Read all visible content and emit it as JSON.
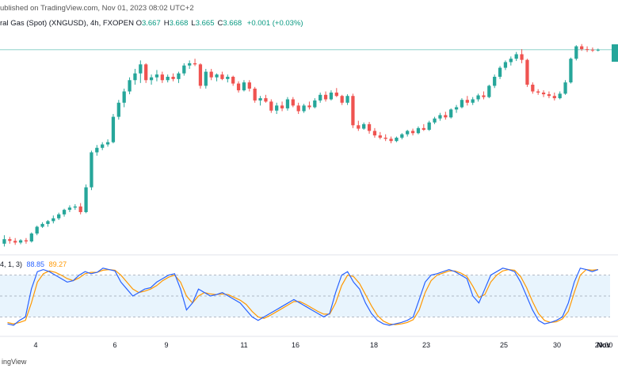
{
  "header": {
    "published": "ublished on TradingView.com, Nov 01, 2023 08:02 UTC+2",
    "symbol": "ral Gas (Spot) (XNGUSD), 4h, FXOPEN",
    "ohlc": [
      {
        "label": "O",
        "value": "3.667"
      },
      {
        "label": "H",
        "value": "3.668"
      },
      {
        "label": "L",
        "value": "3.665"
      },
      {
        "label": "C",
        "value": "3.668"
      }
    ],
    "change": "+0.001 (+0.03%)"
  },
  "indicator": {
    "params": "4, 1, 3)",
    "k_value": "88.85",
    "d_value": "89.27"
  },
  "footer": {
    "text": "ingView"
  },
  "colors": {
    "up": "#26a69a",
    "down": "#ef5350",
    "k_line": "#2962ff",
    "d_line": "#ff9800",
    "band": "#e8f4fd",
    "price_line": "#26a69a"
  },
  "chart_data": [
    {
      "type": "candlestick",
      "x_tick_labels": [
        "4",
        "6",
        "9",
        "11",
        "16",
        "18",
        "23",
        "25",
        "30",
        "Nov",
        "20:00"
      ],
      "candles": [
        [
          0.1,
          0.25,
          0.05,
          0.18
        ],
        [
          0.18,
          0.22,
          0.1,
          0.15
        ],
        [
          0.15,
          0.2,
          0.08,
          0.12
        ],
        [
          0.12,
          0.18,
          0.09,
          0.16
        ],
        [
          0.16,
          0.2,
          0.1,
          0.14
        ],
        [
          0.14,
          0.3,
          0.12,
          0.28
        ],
        [
          0.28,
          0.42,
          0.25,
          0.4
        ],
        [
          0.4,
          0.48,
          0.38,
          0.45
        ],
        [
          0.45,
          0.52,
          0.4,
          0.5
        ],
        [
          0.5,
          0.6,
          0.46,
          0.55
        ],
        [
          0.55,
          0.65,
          0.52,
          0.62
        ],
        [
          0.62,
          0.72,
          0.58,
          0.7
        ],
        [
          0.7,
          0.78,
          0.66,
          0.74
        ],
        [
          0.74,
          0.8,
          0.7,
          0.76
        ],
        [
          0.76,
          0.82,
          0.62,
          0.66
        ],
        [
          0.66,
          1.15,
          0.64,
          1.1
        ],
        [
          1.1,
          1.75,
          1.05,
          1.72
        ],
        [
          1.72,
          1.85,
          1.66,
          1.8
        ],
        [
          1.8,
          1.9,
          1.76,
          1.86
        ],
        [
          1.86,
          1.95,
          1.82,
          1.9
        ],
        [
          1.9,
          2.4,
          1.88,
          2.35
        ],
        [
          2.35,
          2.65,
          2.3,
          2.6
        ],
        [
          2.6,
          2.85,
          2.52,
          2.8
        ],
        [
          2.8,
          3.05,
          2.75,
          3.0
        ],
        [
          3.0,
          3.2,
          2.92,
          3.12
        ],
        [
          3.12,
          3.35,
          2.95,
          3.28
        ],
        [
          3.28,
          3.3,
          2.95,
          3.0
        ],
        [
          3.0,
          3.1,
          2.92,
          3.05
        ],
        [
          3.05,
          3.18,
          2.98,
          3.1
        ],
        [
          3.1,
          3.15,
          2.95,
          3.0
        ],
        [
          3.0,
          3.1,
          2.96,
          3.06
        ],
        [
          3.06,
          3.12,
          2.98,
          3.02
        ],
        [
          3.02,
          3.15,
          2.95,
          3.12
        ],
        [
          3.12,
          3.3,
          3.08,
          3.26
        ],
        [
          3.26,
          3.35,
          3.2,
          3.3
        ],
        [
          3.3,
          3.38,
          3.25,
          3.28
        ],
        [
          3.28,
          3.3,
          2.85,
          2.9
        ],
        [
          2.9,
          3.2,
          2.85,
          3.15
        ],
        [
          3.15,
          3.2,
          3.0,
          3.05
        ],
        [
          3.05,
          3.12,
          2.98,
          3.1
        ],
        [
          3.1,
          3.15,
          3.0,
          3.02
        ],
        [
          3.02,
          3.1,
          2.96,
          3.06
        ],
        [
          3.06,
          3.08,
          2.9,
          2.94
        ],
        [
          2.94,
          2.98,
          2.78,
          2.82
        ],
        [
          2.82,
          3.0,
          2.8,
          2.96
        ],
        [
          2.96,
          3.0,
          2.8,
          2.85
        ],
        [
          2.85,
          2.88,
          2.6,
          2.64
        ],
        [
          2.64,
          2.72,
          2.55,
          2.68
        ],
        [
          2.68,
          2.74,
          2.6,
          2.62
        ],
        [
          2.62,
          2.66,
          2.42,
          2.46
        ],
        [
          2.46,
          2.6,
          2.4,
          2.55
        ],
        [
          2.55,
          2.62,
          2.45,
          2.5
        ],
        [
          2.5,
          2.7,
          2.46,
          2.66
        ],
        [
          2.66,
          2.7,
          2.52,
          2.55
        ],
        [
          2.55,
          2.6,
          2.4,
          2.45
        ],
        [
          2.45,
          2.58,
          2.42,
          2.55
        ],
        [
          2.55,
          2.62,
          2.48,
          2.52
        ],
        [
          2.52,
          2.68,
          2.5,
          2.64
        ],
        [
          2.64,
          2.78,
          2.6,
          2.74
        ],
        [
          2.74,
          2.8,
          2.62,
          2.66
        ],
        [
          2.66,
          2.82,
          2.64,
          2.78
        ],
        [
          2.78,
          2.86,
          2.7,
          2.72
        ],
        [
          2.72,
          2.74,
          2.56,
          2.6
        ],
        [
          2.6,
          2.75,
          2.56,
          2.72
        ],
        [
          2.72,
          2.76,
          2.15,
          2.2
        ],
        [
          2.2,
          2.28,
          2.1,
          2.14
        ],
        [
          2.14,
          2.25,
          2.12,
          2.22
        ],
        [
          2.22,
          2.26,
          2.05,
          2.1
        ],
        [
          2.1,
          2.15,
          1.98,
          2.02
        ],
        [
          2.02,
          2.08,
          1.95,
          1.98
        ],
        [
          1.98,
          2.04,
          1.92,
          1.96
        ],
        [
          1.96,
          2.0,
          1.88,
          1.92
        ],
        [
          1.92,
          2.0,
          1.9,
          1.98
        ],
        [
          1.98,
          2.06,
          1.95,
          2.04
        ],
        [
          2.04,
          2.12,
          2.0,
          2.1
        ],
        [
          2.1,
          2.14,
          2.02,
          2.06
        ],
        [
          2.06,
          2.18,
          2.04,
          2.15
        ],
        [
          2.15,
          2.22,
          2.1,
          2.12
        ],
        [
          2.12,
          2.28,
          2.1,
          2.25
        ],
        [
          2.25,
          2.35,
          2.22,
          2.32
        ],
        [
          2.32,
          2.42,
          2.28,
          2.38
        ],
        [
          2.38,
          2.44,
          2.3,
          2.34
        ],
        [
          2.34,
          2.5,
          2.32,
          2.48
        ],
        [
          2.48,
          2.56,
          2.42,
          2.52
        ],
        [
          2.52,
          2.68,
          2.5,
          2.65
        ],
        [
          2.65,
          2.72,
          2.55,
          2.6
        ],
        [
          2.6,
          2.7,
          2.56,
          2.66
        ],
        [
          2.66,
          2.76,
          2.62,
          2.73
        ],
        [
          2.73,
          2.8,
          2.66,
          2.7
        ],
        [
          2.7,
          2.92,
          2.68,
          2.9
        ],
        [
          2.9,
          3.1,
          2.86,
          3.06
        ],
        [
          3.06,
          3.25,
          3.02,
          3.22
        ],
        [
          3.22,
          3.35,
          3.18,
          3.32
        ],
        [
          3.32,
          3.42,
          3.26,
          3.38
        ],
        [
          3.38,
          3.5,
          3.34,
          3.46
        ],
        [
          3.46,
          3.55,
          3.3,
          3.36
        ],
        [
          3.36,
          3.38,
          2.88,
          2.92
        ],
        [
          2.92,
          2.96,
          2.76,
          2.8
        ],
        [
          2.8,
          2.84,
          2.74,
          2.78
        ],
        [
          2.78,
          2.82,
          2.7,
          2.75
        ],
        [
          2.75,
          2.8,
          2.68,
          2.72
        ],
        [
          2.72,
          2.78,
          2.64,
          2.68
        ],
        [
          2.68,
          2.8,
          2.66,
          2.76
        ],
        [
          2.76,
          3.0,
          2.74,
          2.96
        ],
        [
          2.96,
          3.4,
          2.94,
          3.38
        ],
        [
          3.38,
          3.62,
          3.35,
          3.6
        ],
        [
          3.6,
          3.64,
          3.52,
          3.55
        ],
        [
          3.55,
          3.6,
          3.5,
          3.54
        ],
        [
          3.54,
          3.58,
          3.5,
          3.53
        ],
        [
          3.53,
          3.56,
          3.51,
          3.54
        ]
      ],
      "price_line": 3.54
    },
    {
      "type": "line",
      "series": [
        {
          "values": [
            10,
            8,
            15,
            20,
            60,
            85,
            88,
            85,
            80,
            75,
            70,
            72,
            80,
            85,
            82,
            84,
            90,
            88,
            86,
            70,
            60,
            50,
            55,
            60,
            62,
            70,
            75,
            80,
            82,
            60,
            30,
            40,
            60,
            55,
            50,
            52,
            55,
            50,
            45,
            40,
            30,
            20,
            15,
            20,
            25,
            30,
            35,
            40,
            45,
            40,
            35,
            30,
            25,
            20,
            25,
            55,
            80,
            85,
            70,
            60,
            40,
            25,
            15,
            10,
            8,
            10,
            12,
            15,
            20,
            45,
            70,
            80,
            82,
            85,
            88,
            85,
            80,
            75,
            50,
            40,
            60,
            80,
            85,
            90,
            88,
            85,
            70,
            50,
            30,
            15,
            10,
            12,
            15,
            20,
            40,
            70,
            90,
            88,
            85,
            88
          ]
        },
        {
          "values": [
            12,
            10,
            12,
            15,
            40,
            70,
            82,
            86,
            84,
            80,
            75,
            72,
            76,
            82,
            84,
            84,
            87,
            88,
            87,
            80,
            70,
            60,
            55,
            57,
            60,
            65,
            72,
            77,
            80,
            70,
            50,
            40,
            50,
            55,
            53,
            52,
            53,
            52,
            48,
            44,
            38,
            28,
            20,
            18,
            22,
            27,
            32,
            37,
            42,
            42,
            38,
            33,
            28,
            24,
            24,
            40,
            65,
            80,
            78,
            68,
            52,
            36,
            22,
            14,
            10,
            9,
            10,
            12,
            16,
            30,
            55,
            72,
            80,
            83,
            86,
            86,
            83,
            78,
            64,
            48,
            52,
            70,
            80,
            86,
            88,
            87,
            78,
            62,
            42,
            25,
            15,
            12,
            13,
            17,
            28,
            55,
            80,
            88,
            87,
            88
          ]
        }
      ],
      "ylim": [
        0,
        100
      ]
    }
  ]
}
